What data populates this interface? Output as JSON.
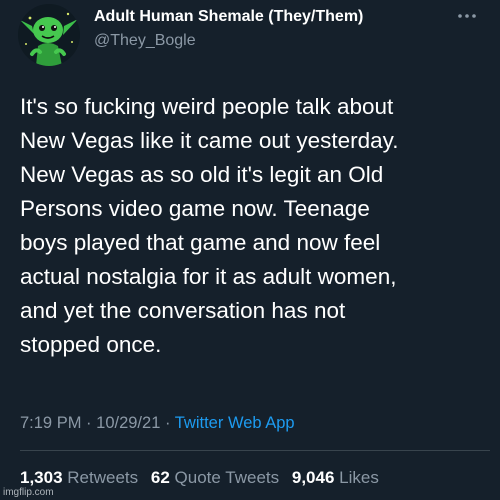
{
  "user": {
    "display_name": "Adult Human Shemale (They/Them)",
    "handle": "@They_Bogle",
    "avatar_icon": "goblin-avatar"
  },
  "tweet": {
    "text": "It's so fucking weird people talk about\nNew Vegas like it came out yesterday.\nNew Vegas as so old it's legit an Old\nPersons video game now. Teenage\nboys played that game and now feel\nactual nostalgia for it as adult women,\nand yet the conversation has not\nstopped once.",
    "time": "7:19 PM",
    "date": "10/29/21",
    "separator": "·",
    "source": "Twitter Web App"
  },
  "stats": {
    "retweets_count": "1,303",
    "retweets_label": "Retweets",
    "quote_count": "62",
    "quote_label": "Quote Tweets",
    "likes_count": "9,046",
    "likes_label": "Likes"
  },
  "watermark": "imgflip.com",
  "colors": {
    "background": "#15202b",
    "text": "#ffffff",
    "muted": "#8b98a5",
    "link": "#1d9bf0",
    "avatar_green": "#3cbf4a"
  },
  "icons": {
    "more": "more-horizontal-icon"
  }
}
